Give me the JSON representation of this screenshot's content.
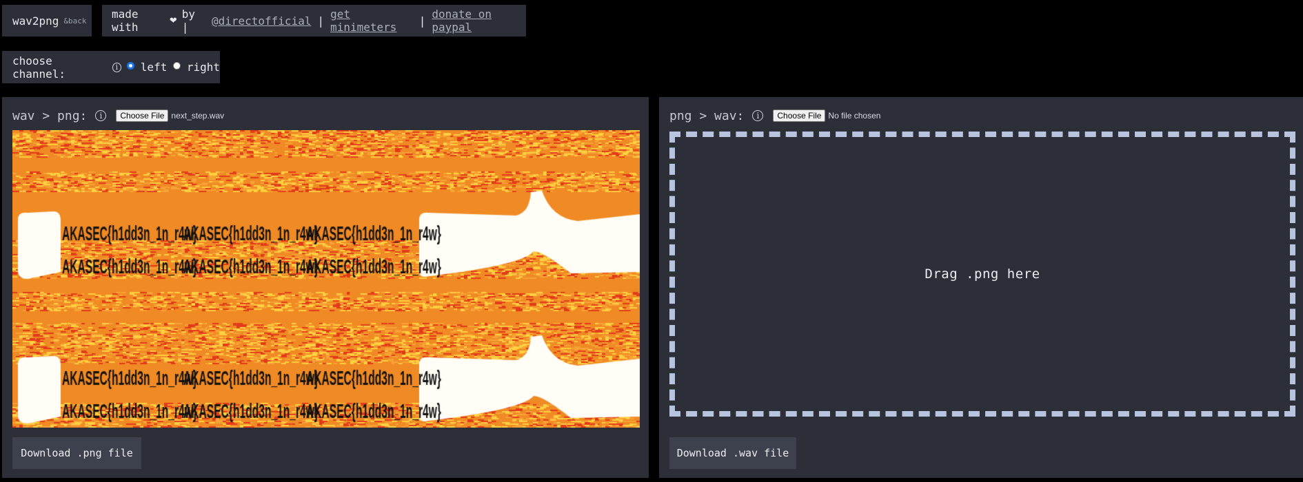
{
  "header": {
    "app_name": "wav2png",
    "app_suffix": "&back",
    "made_with": "made with",
    "heart": "❤",
    "by": "by |",
    "links": [
      "@directofficial",
      "get minimeters",
      "donate on paypal"
    ],
    "separator": "|"
  },
  "channel": {
    "label": "choose channel:",
    "info_glyph": "i",
    "options": [
      {
        "label": "left",
        "checked": true
      },
      {
        "label": "right",
        "checked": false
      }
    ]
  },
  "left_panel": {
    "title": "wav > png:",
    "info_glyph": "i",
    "file_button": "Choose File",
    "file_name": "next_step.wav",
    "spectrogram_text": "AKASEC{h1dd3n_1n_r4w}",
    "colors": {
      "orange": "#f08a24",
      "hot": "#ffd040",
      "red": "#e23a1a",
      "white": "#fffdf5",
      "ink": "#111111"
    },
    "download_label": "Download .png file"
  },
  "right_panel": {
    "title": "png > wav:",
    "info_glyph": "i",
    "file_button": "Choose File",
    "file_name": "No file chosen",
    "drop_text": "Drag .png here",
    "download_label": "Download .wav file"
  }
}
